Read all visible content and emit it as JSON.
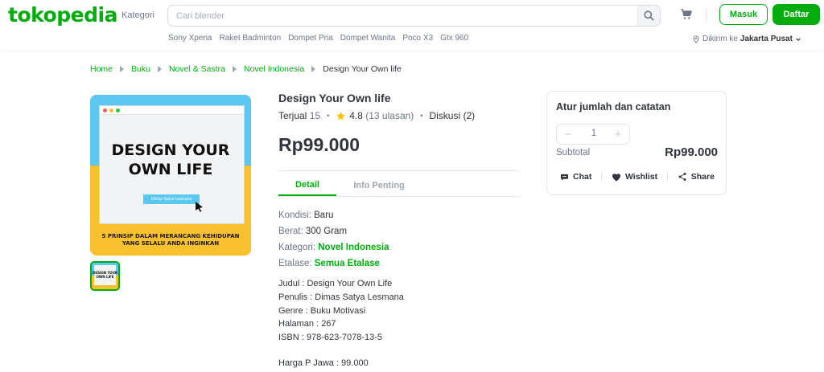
{
  "header": {
    "logo": "tokopedia",
    "kategori": "Kategori",
    "search_placeholder": "Cari blender",
    "login_label": "Masuk",
    "register_label": "Daftar",
    "quick_links": [
      "Sony Xperia",
      "Raket Badminton",
      "Dompet Pria",
      "Dompet Wanita",
      "Poco X3",
      "Gtx 960"
    ],
    "location_prefix": "Dikirim ke",
    "location_city": "Jakarta Pusat",
    "accent_color": "#03ac0e"
  },
  "breadcrumb": [
    "Home",
    "Buku",
    "Novel & Sastra",
    "Novel Indonesia",
    "Design Your Own life"
  ],
  "image": {
    "cover_title_line1": "DESIGN YOUR",
    "cover_title_line2": "OWN LIFE",
    "cover_author": "Dimas Satya Lesmana",
    "cover_subtitle_line1": "5 PRINSIP DALAM MERANCANG KEHIDUPAN",
    "cover_subtitle_line2": "YANG SELALU ANDA INGINKAN",
    "thumb_title_line1": "DESIGN YOUR",
    "thumb_title_line2": "OWN LIFE"
  },
  "product": {
    "title": "Design Your Own life",
    "sold_label": "Terjual",
    "sold_count": "15",
    "rating": "4.8",
    "reviews": "(13 ulasan)",
    "discussion": "Diskusi (2)",
    "price": "Rp99.000",
    "tabs": [
      "Detail",
      "Info Penting"
    ],
    "details": {
      "kondisi_label": "Kondisi:",
      "kondisi_value": "Baru",
      "berat_label": "Berat:",
      "berat_value": "300 Gram",
      "kategori_label": "Kategori:",
      "kategori_value": "Novel Indonesia",
      "etalase_label": "Etalase:",
      "etalase_value": "Semua Etalase"
    },
    "description": [
      "Judul : Design Your Own Life",
      "Penulis : Dimas Satya Lesmana",
      "Genre : Buku Motivasi",
      "Halaman : 267",
      "ISBN : 978-623-7078-13-5"
    ],
    "harga": "Harga P Jawa : 99.000"
  },
  "cart_card": {
    "title": "Atur jumlah dan catatan",
    "quantity": "1",
    "subtotal_label": "Subtotal",
    "subtotal_value": "Rp99.000",
    "chat_label": "Chat",
    "wishlist_label": "Wishlist",
    "share_label": "Share"
  }
}
